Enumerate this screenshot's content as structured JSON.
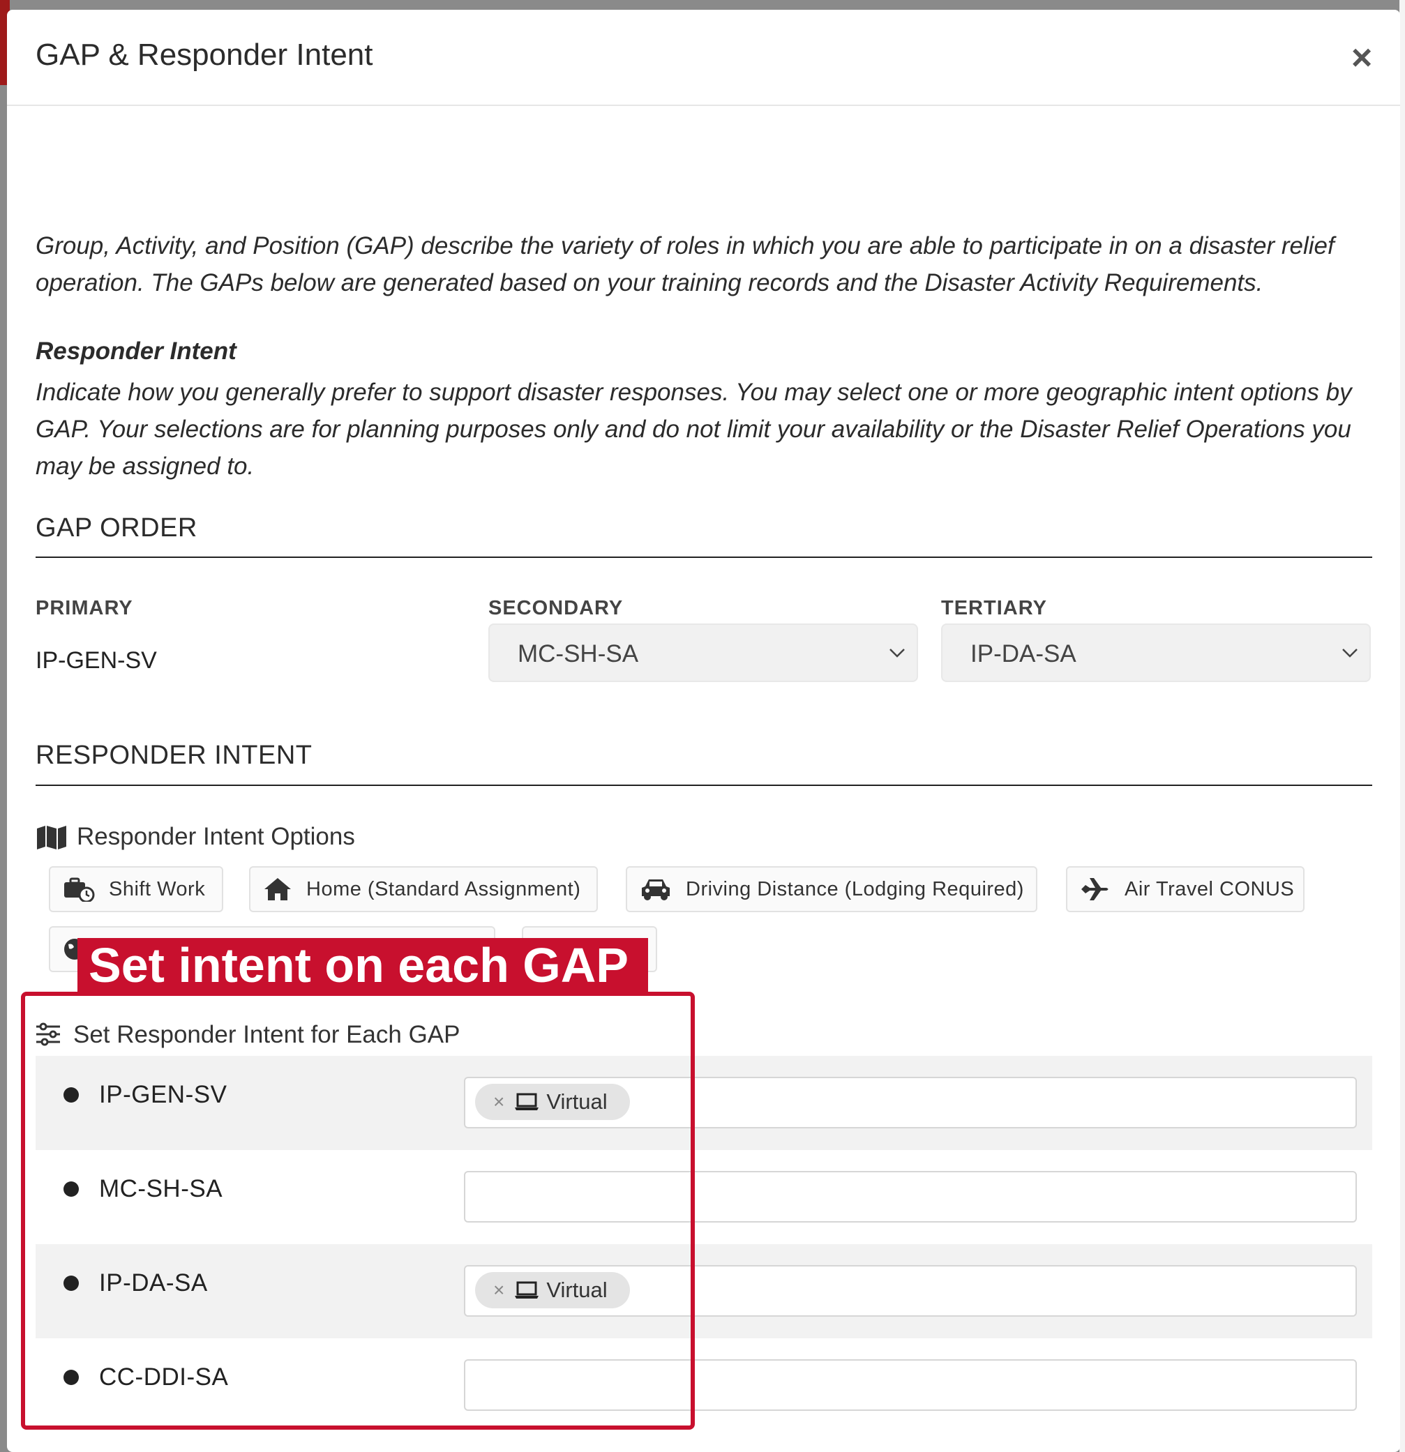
{
  "modal": {
    "title": "GAP & Responder Intent",
    "close_label": "×"
  },
  "intro": "Group, Activity, and Position (GAP) describe the variety of roles in which you are able to participate in on a disaster relief operation. The GAPs below are generated based on your training records and the Disaster Activity Requirements.",
  "responder_intent": {
    "heading": "Responder Intent",
    "text": "Indicate how you generally prefer to support disaster responses. You may select one or more geographic intent options by GAP. Your selections are for planning purposes only and do not limit your availability or the Disaster Relief Operations you may be assigned to."
  },
  "gap_order": {
    "title": "GAP ORDER",
    "primary_label": "PRIMARY",
    "primary_value": "IP-GEN-SV",
    "secondary_label": "SECONDARY",
    "secondary_value": "MC-SH-SA",
    "tertiary_label": "TERTIARY",
    "tertiary_value": "IP-DA-SA"
  },
  "intent_section": {
    "title": "RESPONDER INTENT",
    "options_label": "Responder Intent Options",
    "options": [
      {
        "label": "Shift Work",
        "icon": "briefcase-clock-icon"
      },
      {
        "label": "Home (Standard Assignment)",
        "icon": "home-icon"
      },
      {
        "label": "Driving Distance (Lodging Required)",
        "icon": "car-icon"
      },
      {
        "label": "Air Travel CONUS",
        "icon": "plane-icon"
      }
    ],
    "set_label": "Set Responder Intent for Each GAP"
  },
  "callout": "Set intent on each GAP",
  "gaps": [
    {
      "name": "IP-GEN-SV",
      "chip": "Virtual"
    },
    {
      "name": "MC-SH-SA",
      "chip": ""
    },
    {
      "name": "IP-DA-SA",
      "chip": "Virtual"
    },
    {
      "name": "CC-DDI-SA",
      "chip": ""
    }
  ],
  "colors": {
    "accent_red": "#c8102e",
    "row_shade": "#f2f2f2"
  }
}
